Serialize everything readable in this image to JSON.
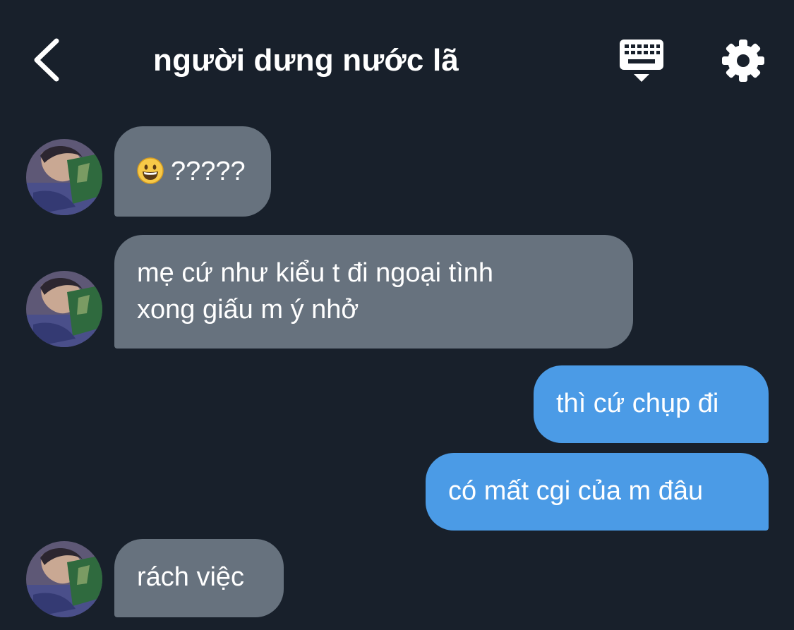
{
  "header": {
    "title": "người dưng nước lã"
  },
  "messages": [
    {
      "direction": "incoming",
      "emoji": "grinning-face",
      "text": "?????"
    },
    {
      "direction": "incoming",
      "lines": [
        "mẹ cứ như kiểu t đi ngoại tình",
        "xong giấu m ý nhở"
      ]
    },
    {
      "direction": "outgoing",
      "text": "thì cứ chụp đi"
    },
    {
      "direction": "outgoing",
      "text": "có mất cgi của m đâu"
    },
    {
      "direction": "incoming",
      "text": "rách việc"
    }
  ],
  "icons": {
    "back": "chevron-left-icon",
    "keyboard": "keyboard-icon",
    "settings": "gear-icon"
  },
  "colors": {
    "background": "#18202b",
    "incoming_bubble": "#67727e",
    "outgoing_bubble": "#4b9be6",
    "text": "#ffffff"
  }
}
